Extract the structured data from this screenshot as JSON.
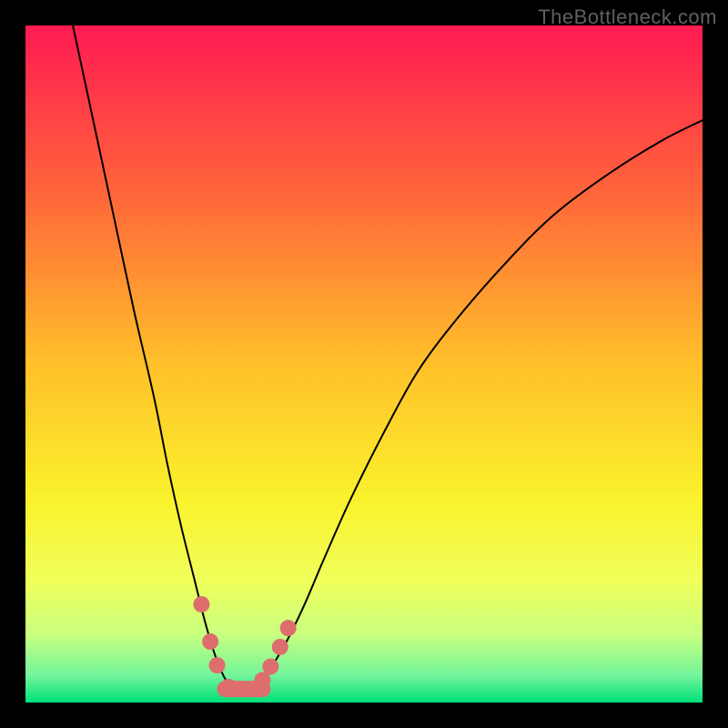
{
  "watermark": "TheBottleneck.com",
  "chart_data": {
    "type": "line",
    "title": "",
    "xlabel": "",
    "ylabel": "",
    "xlim": [
      0,
      100
    ],
    "ylim": [
      0,
      100
    ],
    "grid": false,
    "legend": false,
    "background_gradient": {
      "stops": [
        {
          "offset": 0.0,
          "color": "#ff1a52"
        },
        {
          "offset": 0.25,
          "color": "#ff663a"
        },
        {
          "offset": 0.5,
          "color": "#ffc02a"
        },
        {
          "offset": 0.7,
          "color": "#faf22c"
        },
        {
          "offset": 0.82,
          "color": "#f0ff5a"
        },
        {
          "offset": 0.9,
          "color": "#c8ff80"
        },
        {
          "offset": 0.96,
          "color": "#72f59a"
        },
        {
          "offset": 1.0,
          "color": "#00e07a"
        }
      ]
    },
    "series": [
      {
        "name": "bottleneck-curve",
        "color": "#000000",
        "width": 2,
        "x": [
          7,
          10,
          13,
          16,
          19,
          21,
          23,
          25,
          26.5,
          28,
          29.5,
          31,
          33,
          35,
          38,
          41,
          44,
          48,
          53,
          58,
          64,
          71,
          78,
          86,
          94,
          100
        ],
        "y": [
          100,
          86,
          72,
          58,
          45,
          35,
          26,
          18,
          12,
          7,
          3.5,
          2,
          2,
          3.5,
          8,
          14,
          21,
          30,
          40,
          49,
          57,
          65,
          72,
          78,
          83,
          86
        ]
      }
    ],
    "flat_base": {
      "x_start": 29.5,
      "x_end": 35,
      "y": 2
    },
    "markers": [
      {
        "x": 26.0,
        "y": 14.5
      },
      {
        "x": 27.3,
        "y": 9.0
      },
      {
        "x": 28.3,
        "y": 5.5
      },
      {
        "x": 30.0,
        "y": 2.3
      },
      {
        "x": 31.7,
        "y": 2.0
      },
      {
        "x": 33.3,
        "y": 2.0
      },
      {
        "x": 35.0,
        "y": 3.3
      },
      {
        "x": 36.2,
        "y": 5.3
      },
      {
        "x": 37.6,
        "y": 8.2
      },
      {
        "x": 38.8,
        "y": 11.0
      }
    ],
    "marker_style": {
      "color": "#de6e6e",
      "radius_px": 9
    }
  }
}
